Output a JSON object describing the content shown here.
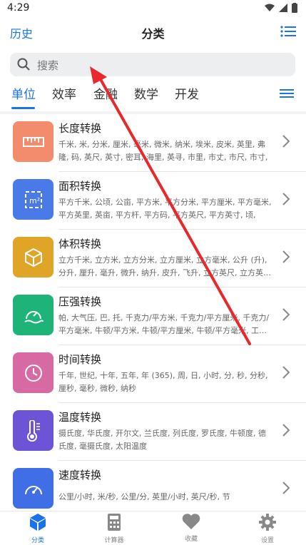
{
  "status": {
    "time": "4:29"
  },
  "header": {
    "history": "历史",
    "title": "分类"
  },
  "search": {
    "placeholder": "搜索"
  },
  "tabs": [
    "单位",
    "效率",
    "金融",
    "数学",
    "开发"
  ],
  "items": [
    {
      "name": "长度转换",
      "desc": "千米, 米, 分米, 厘米, 毫米, 微米, 纳米, 埃米, 皮米, 英里, 弗隆, 码, 英尺, 英寸, 密耳, 海里, 英寻, 市里, 市丈, 市尺, 市寸, 市…",
      "color": "#f38c6d",
      "icon": "ruler-icon"
    },
    {
      "name": "面积转换",
      "desc": "平方千米, 公顷, 公亩, 平方米, 平方分米, 平方厘米, 平方毫米, 平方英里, 英亩, 平方杆, 平方码, 平方英尺, 平方英寸, 顷, 亩,…",
      "color": "#4a7ae8",
      "icon": "square-meter-icon"
    },
    {
      "name": "体积转换",
      "desc": "立方千米, 立方米, 立方分米, 立方厘米, 立方毫米, 公升 (升), 分升, 厘升, 毫升, 微升, 纳升, 皮升, 飞升, 立方英尺, 立方英…",
      "color": "#e0a526",
      "icon": "cube-icon"
    },
    {
      "name": "压强转换",
      "desc": "帕, 大气压, 巴, 托, 千克力/平方米, 千克力/平方厘米, 千克力/平方毫米, 牛顿/平方米, 牛顿/平方厘米, 牛顿/平方毫米, 工…",
      "color": "#1fb477",
      "icon": "gauge-icon"
    },
    {
      "name": "时间转换",
      "desc": "千年, 世纪, 十年, 五年, 年 (365), 周, 日, 小时, 分, 秒, 分秒, 厘秒, 毫秒, 微秒, 纳秒",
      "color": "#d86aa3",
      "icon": "clock-icon"
    },
    {
      "name": "温度转换",
      "desc": "摄氏度, 华氏度, 开尔文, 兰氏度, 列氏度, 罗氏度, 牛顿度, 德氏度, 毫摄氏度, 太阳温度",
      "color": "#6d54d6",
      "icon": "thermometer-icon"
    },
    {
      "name": "速度转换",
      "desc": "公里/小时, 米/秒, 公里/分, 英里/小时, 英尺/秒, 节",
      "color": "#3f6ee6",
      "icon": "speedometer-icon"
    }
  ],
  "bottom_nav": [
    "分类",
    "计算器",
    "收藏",
    "设置"
  ],
  "colors": {
    "accent": "#1a73e8",
    "arrow": "#e8282a"
  }
}
